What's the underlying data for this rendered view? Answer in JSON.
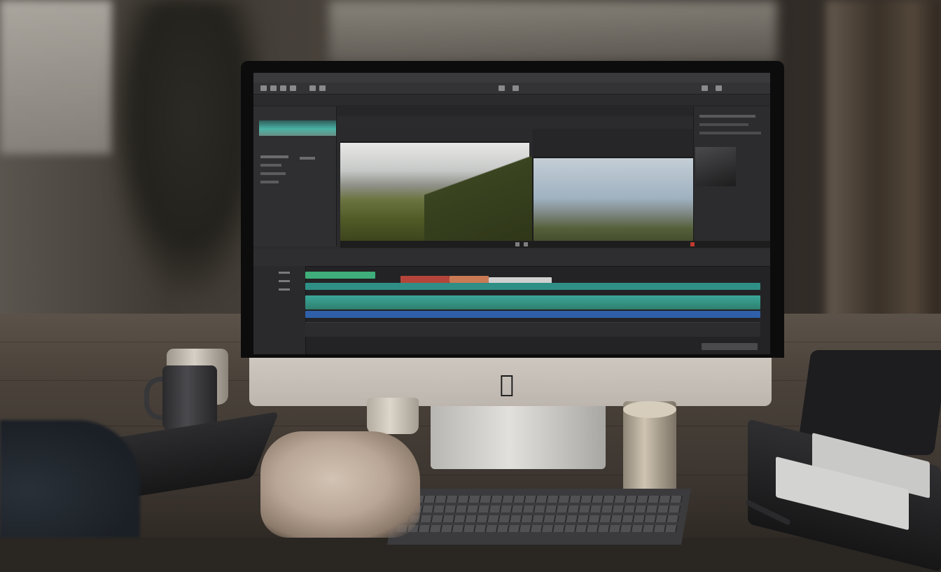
{
  "scene": {
    "description_free": true,
    "brand_mark": "apple-logo-icon"
  },
  "app": {
    "title": "",
    "media_panel": {
      "labels": [
        "",
        "",
        ""
      ]
    }
  },
  "colors": {
    "clip_green": "#3fae7a",
    "clip_teal": "#2f8f86",
    "clip_blue": "#2f5fa8",
    "clip_red": "#b5453b",
    "clip_orange": "#c97a55"
  }
}
